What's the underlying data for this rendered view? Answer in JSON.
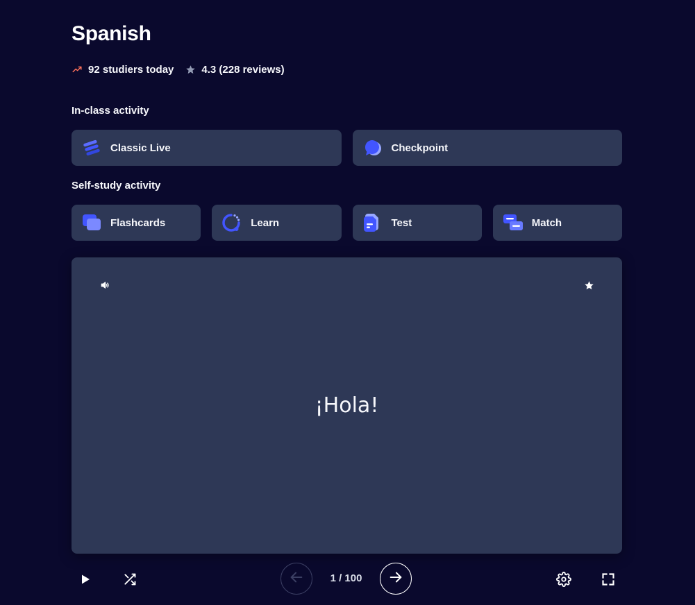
{
  "set": {
    "title": "Spanish",
    "studiers": "92 studiers today",
    "rating": "4.3 (228 reviews)"
  },
  "in_class": {
    "label": "In-class activity",
    "items": [
      {
        "label": "Classic Live",
        "icon": "classic-live-icon"
      },
      {
        "label": "Checkpoint",
        "icon": "checkpoint-icon"
      }
    ]
  },
  "self_study": {
    "label": "Self-study activity",
    "items": [
      {
        "label": "Flashcards",
        "icon": "flashcards-icon"
      },
      {
        "label": "Learn",
        "icon": "learn-icon"
      },
      {
        "label": "Test",
        "icon": "test-icon"
      },
      {
        "label": "Match",
        "icon": "match-icon"
      }
    ]
  },
  "flashcard": {
    "term": "¡Hola!",
    "counter": "1 / 100"
  },
  "colors": {
    "background": "#0a092d",
    "tile": "#2e3856",
    "accent": "#4255ff",
    "trending": "#ff725b",
    "text": "#f6f7fb"
  }
}
